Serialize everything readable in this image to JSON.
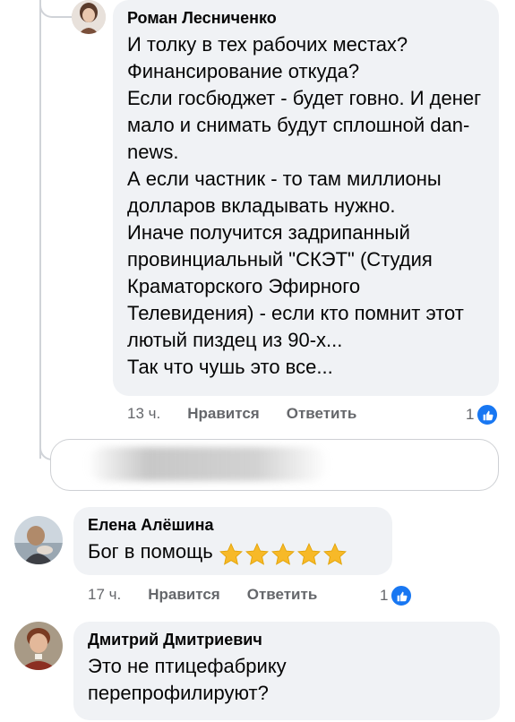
{
  "comments": [
    {
      "author": "Роман Лесниченко",
      "text": "И толку в тех рабочих местах?\nФинансирование откуда?\nЕсли госбюджет - будет говно. И денег мало и снимать будут сплошной dan-news.\nА если частник - то там миллионы долларов вкладывать нужно.\nИначе получится задрипанный провинциальный \"СКЭТ\" (Студия Краматорского Эфирного Телевидения) - если кто помнит этот лютый пиздец из 90-х...\nТак что чушь это все...",
      "time": "13 ч.",
      "like_label": "Нравится",
      "reply_label": "Ответить",
      "reaction_count": "1"
    },
    {
      "author": "Елена Алёшина",
      "text": "Бог в помощь",
      "time": "17 ч.",
      "like_label": "Нравится",
      "reply_label": "Ответить",
      "reaction_count": "1"
    },
    {
      "author": "Дмитрий Дмитриевич",
      "text": "Это не птицефабрику\nперепрофилируют?"
    }
  ],
  "colors": {
    "bubble": "#f0f2f5",
    "meta": "#65676b",
    "like_blue": "#1877f2",
    "star": "#f7b928"
  },
  "icons": {
    "reaction": "thumbs-up-icon",
    "stars": "star-emoji-icon"
  }
}
